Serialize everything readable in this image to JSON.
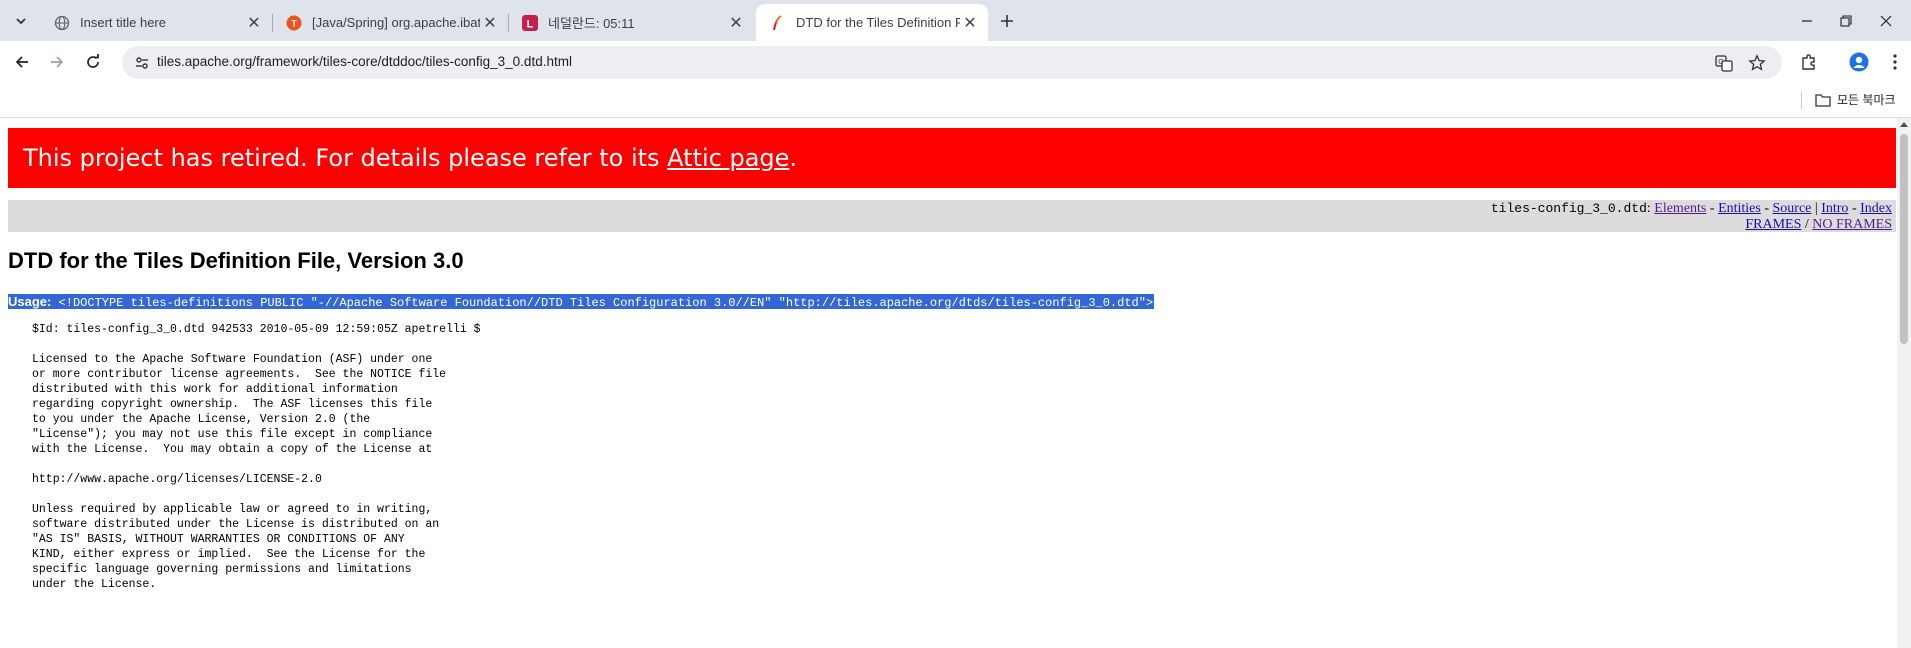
{
  "browser": {
    "tabs": [
      {
        "title": "Insert title here",
        "favicon": "globe-icon"
      },
      {
        "title": "[Java/Spring] org.apache.ibatis",
        "favicon": "tistory-icon"
      },
      {
        "title": "네덜란드: 05:11",
        "favicon": "site-l-icon"
      },
      {
        "title": "DTD for the Tiles Definition File",
        "favicon": "apache-feather-icon",
        "active": true
      }
    ],
    "address": "tiles.apache.org/framework/tiles-core/dtddoc/tiles-config_3_0.dtd.html",
    "bookmarks_all": "모든 북마크",
    "tistory_letter": "T",
    "site_letter": "L"
  },
  "page": {
    "banner": {
      "text_before": "This project has retired. For details please refer to its ",
      "link": "Attic page",
      "text_after": "."
    },
    "nav": {
      "file": "tiles-config_3_0.dtd",
      "colon": ":",
      "elements": "Elements",
      "entities": "Entities",
      "source": "Source",
      "intro": "Intro",
      "index": "Index",
      "frames": "FRAMES",
      "no_frames": "NO FRAMES",
      "dash": " - ",
      "pipe": " | ",
      "slash": " / "
    },
    "title": "DTD for the Tiles Definition File, Version 3.0",
    "usage_label": "Usage:",
    "usage_doctype": " <!DOCTYPE tiles-definitions PUBLIC \"-//Apache Software Foundation//DTD Tiles Configuration 3.0//EN\" \"http://tiles.apache.org/dtds/tiles-config_3_0.dtd\">",
    "license_text": "$Id: tiles-config_3_0.dtd 942533 2010-05-09 12:59:05Z apetrelli $\n\nLicensed to the Apache Software Foundation (ASF) under one\nor more contributor license agreements.  See the NOTICE file\ndistributed with this work for additional information\nregarding copyright ownership.  The ASF licenses this file\nto you under the Apache License, Version 2.0 (the\n\"License\"); you may not use this file except in compliance\nwith the License.  You may obtain a copy of the License at\n\nhttp://www.apache.org/licenses/LICENSE-2.0\n\nUnless required by applicable law or agreed to in writing,\nsoftware distributed under the License is distributed on an\n\"AS IS\" BASIS, WITHOUT WARRANTIES OR CONDITIONS OF ANY\nKIND, either express or implied.  See the License for the\nspecific language governing permissions and limitations\nunder the License."
  },
  "colors": {
    "banner": "#ff0000",
    "selection": "#3367d6",
    "navbar": "#dcdcdc",
    "tabbar": "#dfe3eb"
  }
}
